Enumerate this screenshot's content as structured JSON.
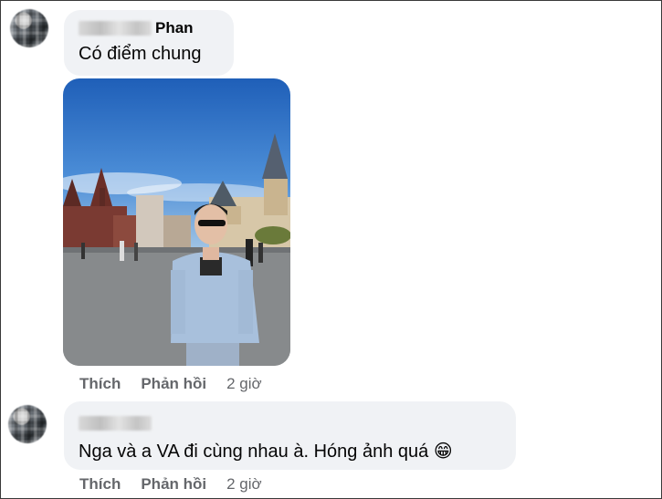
{
  "comments": [
    {
      "name": "Phan",
      "text": "Có điểm chung",
      "actions": {
        "like": "Thích",
        "reply": "Phản hồi",
        "time": "2 giờ"
      }
    },
    {
      "name": "",
      "text": "Nga và a VA đi cùng nhau à. Hóng ảnh quá",
      "emoji": "😁",
      "actions": {
        "like": "Thích",
        "reply": "Phản hồi",
        "time": "2 giờ"
      }
    }
  ],
  "colors": {
    "bubble": "#f0f2f5",
    "action_text": "#65676b",
    "emoji_face": "#f5c33b"
  }
}
